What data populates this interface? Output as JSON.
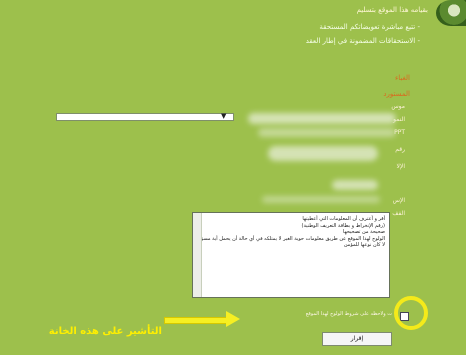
{
  "intro": {
    "heading": "بقيامه هذا الموقع بتسليم",
    "line1": "- تتبع مباشرة تعويضاتكم المستحقة",
    "line2": "- الاستحقاقات المضمونة في إطار العقد"
  },
  "sections": {
    "first": "الغباء",
    "second": "المستورد"
  },
  "fields": [
    "موس",
    "النمو",
    "PPT",
    "رقم",
    "الإلا",
    "الإس",
    "الفف"
  ],
  "select": {
    "arrow": "▼"
  },
  "terms": {
    "lines": [
      "أقر و أعترف أن المعلومات التي أعطيتها",
      "(رقم الإنخراط و بطاقة التعريف الوطنية)",
      "صحيحة من تصحيحها",
      "الولوج لهذا الموقع عن طريق معلومات حوية الغير لا يمتلكه في أي حالة أن يحمل أية مسؤولية",
      "لا كان نوعها للمؤمن"
    ]
  },
  "agree_text": "ت ولاحظه على شروط الولوج لهذا الموقع",
  "hint_text": "التأشير على هذه الخانة",
  "submit_label": "إقرار",
  "colors": {
    "background": "#9dc04c",
    "highlight": "#f4ea1a",
    "section_title": "#d96a1f"
  }
}
